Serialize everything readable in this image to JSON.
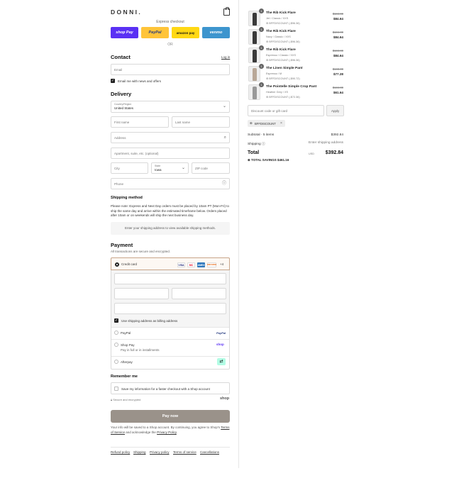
{
  "brand": {
    "name": "DONNI."
  },
  "express": {
    "title": "Express checkout",
    "buttons": [
      {
        "label": "shop Pay",
        "bg": "#5a31f4",
        "fg": "#ffffff"
      },
      {
        "label": "PayPal",
        "bg": "#ffc439",
        "fg": "#253b80"
      },
      {
        "label": "amazon pay",
        "bg": "#ffd814",
        "fg": "#111111"
      },
      {
        "label": "venmo",
        "bg": "#3d95ce",
        "fg": "#ffffff"
      }
    ],
    "or": "OR"
  },
  "contact": {
    "title": "Contact",
    "login": "Log in",
    "email_placeholder": "Email",
    "newsletter": "Email me with news and offers"
  },
  "delivery": {
    "title": "Delivery",
    "country_label": "Country/Region",
    "country_value": "United States",
    "first_name": "First name",
    "last_name": "Last name",
    "address": "Address",
    "apartment": "Apartment, suite, etc. (optional)",
    "city": "City",
    "state_label": "State",
    "state_value": "Iowa",
    "zip": "ZIP code",
    "phone": "Phone"
  },
  "shipping": {
    "title": "Shipping method",
    "note": "Please note: Express and Next Day orders must be placed by 10am PT (Mon-Fri) to ship the same day and arrive within the estimated timeframe below. Orders placed after 10am or on weekends will ship the next business day.",
    "empty": "Enter your shipping address to view available shipping methods."
  },
  "payment": {
    "title": "Payment",
    "subtitle": "All transactions are secure and encrypted.",
    "credit_card": "Credit card",
    "card_logos": [
      {
        "label": "VISA",
        "bg": "#ffffff",
        "fg": "#1a1f71"
      },
      {
        "label": "MC",
        "bg": "#ffffff",
        "fg": "#eb001b"
      },
      {
        "label": "AMEX",
        "bg": "#2e77bc",
        "fg": "#ffffff"
      },
      {
        "label": "DISCOVER",
        "bg": "#ffffff",
        "fg": "#e65c00"
      }
    ],
    "more_cards": "+4",
    "billing_same": "Use shipping address as billing address",
    "options": [
      {
        "label": "PayPal",
        "sub": "",
        "badge": "PayPal"
      },
      {
        "label": "Shop Pay",
        "sub": "Pay in full or in installments",
        "badge": "shop"
      },
      {
        "label": "Afterpay",
        "sub": "",
        "badge": "⇄"
      }
    ]
  },
  "remember": {
    "title": "Remember me",
    "save": "Save my information for a faster checkout with a Shop account",
    "secure": "Secure and encrypted",
    "shop": "shop"
  },
  "pay_now": "Pay now",
  "legal": {
    "pre": "Your info will be saved to a Shop account. By continuing, you agree to Shop's",
    "tos": "Terms of Service",
    "mid": "and acknowledge the",
    "privacy": "Privacy Policy",
    "end": "."
  },
  "footer": [
    "Refund policy",
    "Shipping",
    "Privacy policy",
    "Terms of service",
    "Cancellations"
  ],
  "cart": {
    "items": [
      {
        "qty": "1",
        "name": "The Rib Kick Flare",
        "variant": "Jet / Classic / XXS",
        "discount": "BFFDISCOUNT (-$96.36)",
        "old": "$184.00",
        "new": "$84.64"
      },
      {
        "qty": "1",
        "name": "The Rib Kick Flare",
        "variant": "Navy / Classic / XXS",
        "discount": "BFFDISCOUNT (-$96.36)",
        "old": "$184.00",
        "new": "$84.64"
      },
      {
        "qty": "1",
        "name": "The Rib Kick Flare",
        "variant": "Espresso / Classic / XXS",
        "discount": "BFFDISCOUNT (-$96.36)",
        "old": "$184.00",
        "new": "$84.64"
      },
      {
        "qty": "1",
        "name": "The Linen Simple Pant",
        "variant": "Espresso / M",
        "discount": "BFFDISCOUNT (-$90.72)",
        "old": "$168.00",
        "new": "$77.28"
      },
      {
        "qty": "1",
        "name": "The Pointelle Simple Crop Pant",
        "variant": "Heather Grey / XS",
        "discount": "BFFDISCOUNT (-$72.36)",
        "old": "$134.00",
        "new": "$61.64"
      }
    ],
    "discount_placeholder": "Discount code or gift card",
    "apply": "Apply",
    "applied_code": "BFFDISCOUNT",
    "subtotal_label": "Subtotal · 5 items",
    "subtotal_value": "$392.84",
    "shipping_label": "Shipping",
    "shipping_value": "Enter shipping address",
    "total_label": "Total",
    "currency": "USD",
    "total_value": "$392.84",
    "savings_label": "TOTAL SAVINGS",
    "savings_value": "$461.16"
  }
}
